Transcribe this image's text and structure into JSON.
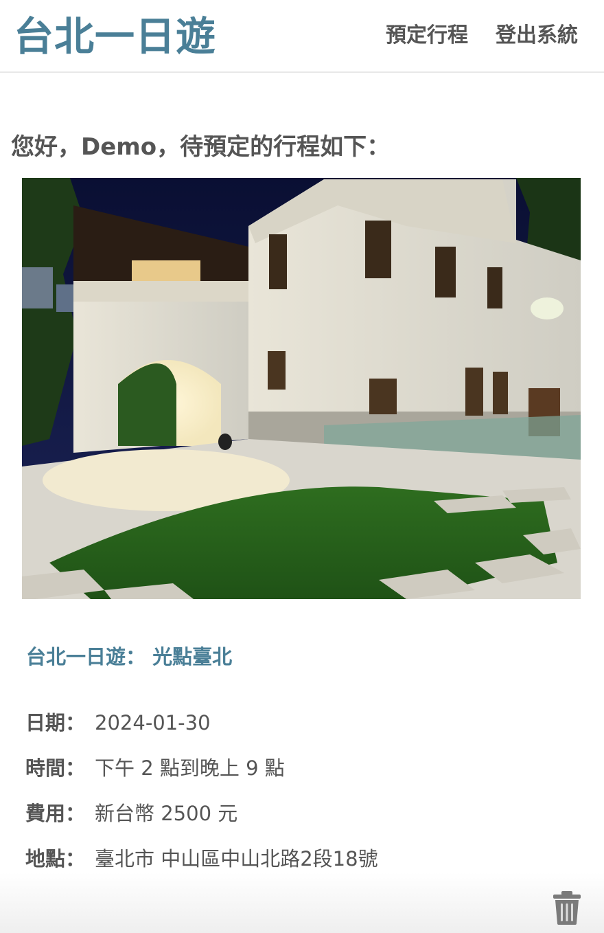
{
  "header": {
    "brand": "台北一日遊",
    "nav": [
      {
        "label": "預定行程"
      },
      {
        "label": "登出系統"
      }
    ]
  },
  "greeting": "您好，Demo，待預定的行程如下：",
  "trip": {
    "title": "台北一日遊： 光點臺北",
    "details": [
      {
        "label": "日期：",
        "value": "2024-01-30"
      },
      {
        "label": "時間：",
        "value": "下午 2 點到晚上 9 點"
      },
      {
        "label": "費用：",
        "value": "新台幣 2500 元"
      },
      {
        "label": "地點：",
        "value": "臺北市 中山區中山北路2段18號"
      }
    ]
  },
  "icons": {
    "delete": "trash-icon"
  },
  "colors": {
    "brand": "#4a7f97",
    "text": "#555555",
    "divider": "#e8e8e8"
  }
}
